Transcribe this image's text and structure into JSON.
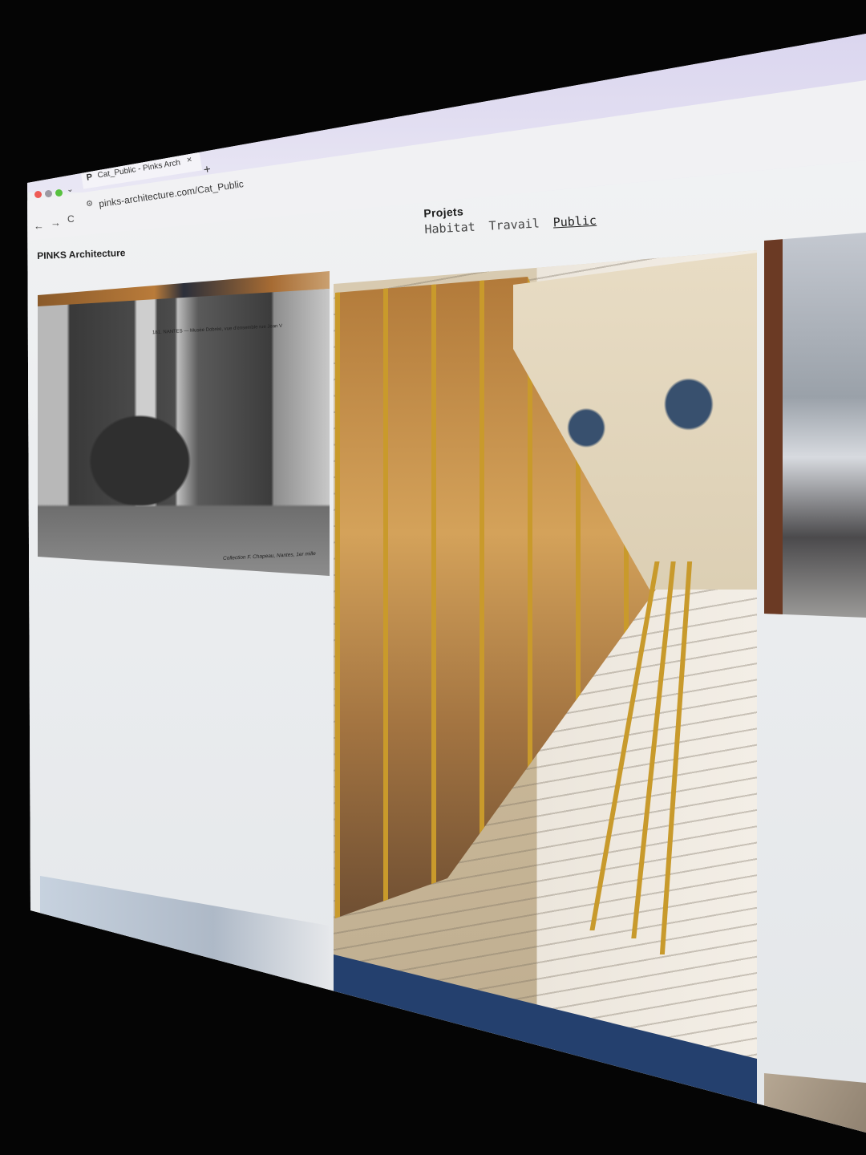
{
  "browser": {
    "tab": {
      "favicon": "P",
      "title": "Cat_Public - Pinks Architecture",
      "close": "×"
    },
    "new_tab": "+",
    "nav": {
      "back": "←",
      "forward": "→",
      "reload": "C"
    },
    "address": {
      "icon": "site-settings-icon",
      "url": "pinks-architecture.com/Cat_Public"
    }
  },
  "site": {
    "brand": "PINKS Architecture",
    "nav": {
      "title": "Projets",
      "links": [
        {
          "label": "Habitat",
          "active": false
        },
        {
          "label": "Travail",
          "active": false
        },
        {
          "label": "Public",
          "active": true
        }
      ]
    }
  },
  "gallery": {
    "postcard": {
      "caption": "181. NANTES — Musée Dobrée, vue d'ensemble rue Jean V",
      "credit": "Collection F. Chapeau, Nantes, 1er mille"
    }
  }
}
